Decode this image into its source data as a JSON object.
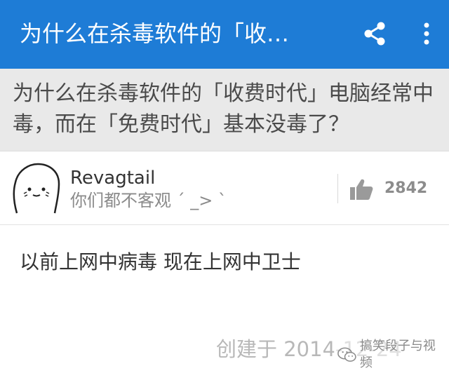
{
  "appbar": {
    "title": "为什么在杀毒软件的「收…",
    "share_icon": "share-icon",
    "more_icon": "more-vertical-icon",
    "bg_color": "#1e7cd6"
  },
  "question": {
    "text": "为什么在杀毒软件的「收费时代」电脑经常中毒，而在「免费时代」基本没毒了？"
  },
  "author": {
    "name": "Revagtail",
    "bio": "你们都不客观 ´ _> `",
    "avatar_icon": "cartoon-face-avatar"
  },
  "votes": {
    "count": "2842",
    "icon": "thumbs-up-icon"
  },
  "answer": {
    "text": "以前上网中病毒 现在上网中卫士"
  },
  "meta": {
    "created": "创建于 2014-12-24"
  },
  "watermark": {
    "text": "搞笑段子与视频",
    "icon": "wechat-icon"
  }
}
